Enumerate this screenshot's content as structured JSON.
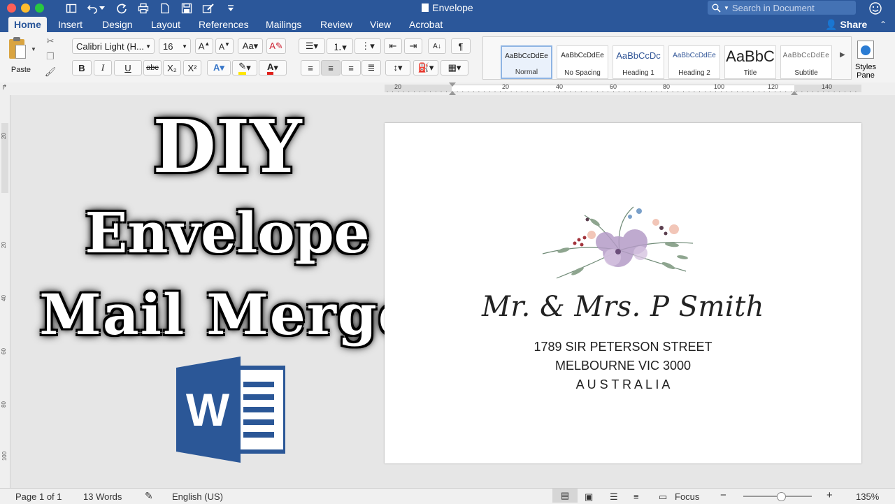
{
  "window": {
    "title": "Envelope",
    "search_placeholder": "Search in Document"
  },
  "tabs": [
    {
      "label": "Home"
    },
    {
      "label": "Insert"
    },
    {
      "label": "Design"
    },
    {
      "label": "Layout"
    },
    {
      "label": "References"
    },
    {
      "label": "Mailings"
    },
    {
      "label": "Review"
    },
    {
      "label": "View"
    },
    {
      "label": "Acrobat"
    }
  ],
  "share_label": "Share",
  "ribbon": {
    "paste_label": "Paste",
    "font_name": "Calibri Light (H...",
    "font_size": "16",
    "bold": "B",
    "italic": "I",
    "underline": "U",
    "strike": "abc",
    "subscript": "X₂",
    "superscript": "X²",
    "styles": [
      {
        "preview": "AaBbCcDdEe",
        "name": "Normal"
      },
      {
        "preview": "AaBbCcDdEe",
        "name": "No Spacing"
      },
      {
        "preview": "AaBbCcDc",
        "name": "Heading 1"
      },
      {
        "preview": "AaBbCcDdEe",
        "name": "Heading 2"
      },
      {
        "preview": "AaBbC",
        "name": "Title"
      },
      {
        "preview": "AaBbCcDdEe",
        "name": "Subtitle"
      }
    ],
    "styles_pane_label": "Styles Pane"
  },
  "ruler": {
    "labels": [
      "20",
      "20",
      "40",
      "60",
      "80",
      "100",
      "120",
      "140"
    ]
  },
  "vruler": {
    "labels": [
      "20",
      "20",
      "40",
      "60",
      "80",
      "100"
    ]
  },
  "overlay": {
    "line1": "DIY",
    "line2": "Envelope",
    "line3": "Mail Merge",
    "logo_letter": "W"
  },
  "envelope": {
    "name": "Mr. & Mrs. P Smith",
    "street": "1789 SIR PETERSON STREET",
    "city": "MELBOURNE VIC 3000",
    "country": "A U S T R A L I A"
  },
  "status": {
    "page": "Page 1 of 1",
    "words": "13 Words",
    "language": "English (US)",
    "focus": "Focus",
    "zoom": "135%"
  },
  "colors": {
    "brand": "#2b579a",
    "logo": "#2b5797"
  }
}
